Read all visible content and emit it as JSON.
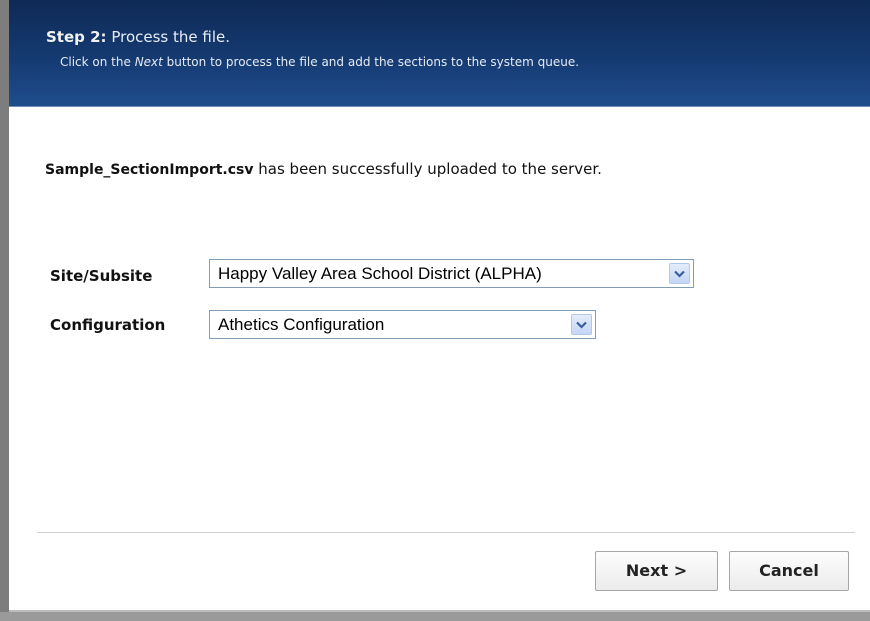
{
  "header": {
    "step_label": "Step 2:",
    "step_text": "Process the file.",
    "desc_before": "Click on the ",
    "desc_emphasis": "Next",
    "desc_after": " button to process the file and add the sections to the system queue."
  },
  "upload": {
    "filename": "Sample_SectionImport.csv",
    "message": " has been successfully uploaded to the server."
  },
  "form": {
    "site": {
      "label": "Site/Subsite",
      "selected": "Happy Valley Area School District (ALPHA)"
    },
    "configuration": {
      "label": "Configuration",
      "selected": "Athetics Configuration"
    }
  },
  "buttons": {
    "next_label": "Next >",
    "cancel_label": "Cancel"
  },
  "colors": {
    "header_dark": "#0e2a55",
    "header_light": "#1f4d8c",
    "select_border": "#7f9db9"
  },
  "icons": {
    "dropdown": "chevron-down-icon"
  }
}
